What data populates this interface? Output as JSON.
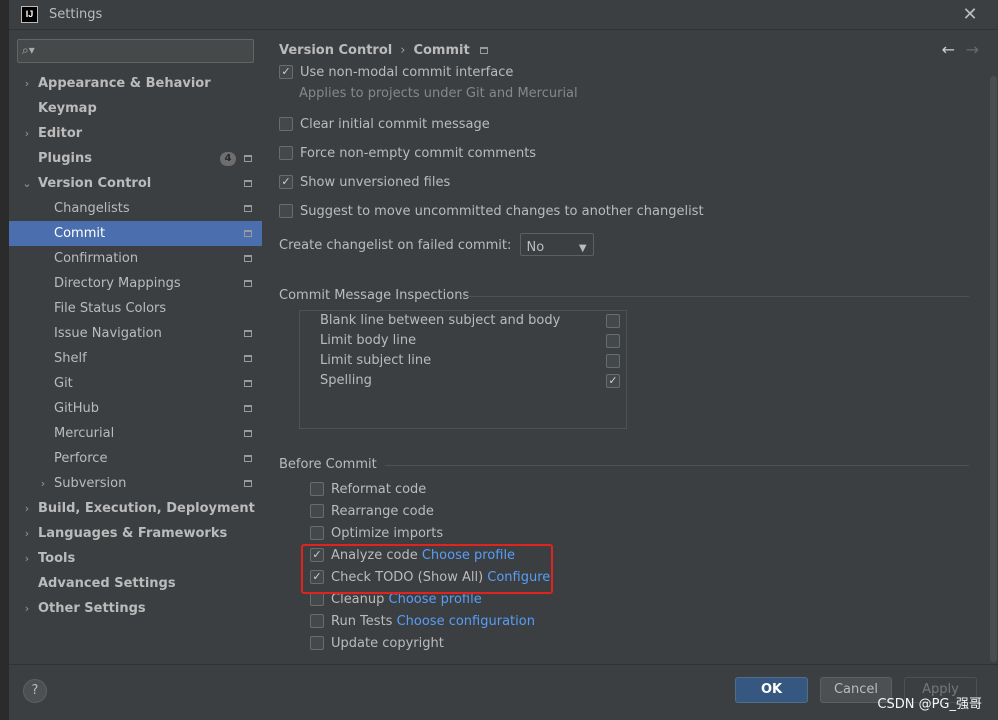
{
  "window": {
    "title": "Settings",
    "app_icon_text": "IJ"
  },
  "search": {
    "placeholder": "",
    "value": ""
  },
  "sidebar": {
    "items": [
      {
        "label": "Appearance & Behavior",
        "arrow": "›",
        "bold": true
      },
      {
        "label": "Keymap",
        "arrow": "",
        "bold": true
      },
      {
        "label": "Editor",
        "arrow": "›",
        "bold": true
      },
      {
        "label": "Plugins",
        "arrow": "",
        "bold": true,
        "badge": "4"
      },
      {
        "label": "Version Control",
        "arrow": "⌄",
        "bold": true
      },
      {
        "label": "Changelists"
      },
      {
        "label": "Commit",
        "selected": true
      },
      {
        "label": "Confirmation"
      },
      {
        "label": "Directory Mappings"
      },
      {
        "label": "File Status Colors"
      },
      {
        "label": "Issue Navigation"
      },
      {
        "label": "Shelf"
      },
      {
        "label": "Git"
      },
      {
        "label": "GitHub"
      },
      {
        "label": "Mercurial"
      },
      {
        "label": "Perforce"
      },
      {
        "label": "Subversion",
        "arrow": "›"
      },
      {
        "label": "Build, Execution, Deployment",
        "arrow": "›",
        "bold": true
      },
      {
        "label": "Languages & Frameworks",
        "arrow": "›",
        "bold": true
      },
      {
        "label": "Tools",
        "arrow": "›",
        "bold": true
      },
      {
        "label": "Advanced Settings",
        "arrow": "",
        "bold": true
      },
      {
        "label": "Other Settings",
        "arrow": "›",
        "bold": true
      }
    ]
  },
  "header": {
    "crumb1": "Version Control",
    "sep": "›",
    "crumb2": "Commit",
    "back": "←",
    "forward": "→"
  },
  "options": {
    "non_modal": {
      "label": "Use non-modal commit interface",
      "checked": true,
      "hint": "Applies to projects under Git and Mercurial"
    },
    "clear_initial": {
      "label": "Clear initial commit message",
      "checked": false
    },
    "force_nonempty": {
      "label": "Force non-empty commit comments",
      "checked": false
    },
    "show_unversioned": {
      "label": "Show unversioned files",
      "checked": true
    },
    "suggest_move": {
      "label": "Suggest to move uncommitted changes to another changelist",
      "checked": false
    },
    "failed_commit": {
      "label": "Create changelist on failed commit:",
      "value": "No"
    }
  },
  "inspections": {
    "title": "Commit Message Inspections",
    "items": [
      {
        "label": "Blank line between subject and body",
        "checked": false
      },
      {
        "label": "Limit body line",
        "checked": false
      },
      {
        "label": "Limit subject line",
        "checked": false
      },
      {
        "label": "Spelling",
        "checked": true
      }
    ]
  },
  "before_commit": {
    "title": "Before Commit",
    "items": [
      {
        "label": "Reformat code",
        "checked": false,
        "link": ""
      },
      {
        "label": "Rearrange code",
        "checked": false,
        "link": ""
      },
      {
        "label": "Optimize imports",
        "checked": false,
        "link": ""
      },
      {
        "label": "Analyze code",
        "checked": true,
        "link": "Choose profile"
      },
      {
        "label": "Check TODO (Show All)",
        "checked": true,
        "link": "Configure"
      },
      {
        "label": "Cleanup",
        "checked": false,
        "link": "Choose profile"
      },
      {
        "label": "Run Tests",
        "checked": false,
        "link": "Choose configuration"
      },
      {
        "label": "Update copyright",
        "checked": false,
        "link": ""
      }
    ]
  },
  "footer": {
    "help": "?",
    "ok": "OK",
    "cancel": "Cancel",
    "apply": "Apply"
  },
  "watermark": "CSDN @PG_强哥",
  "colors": {
    "selection": "#4b6eaf",
    "link": "#589df6",
    "highlight": "#e0231e",
    "ok_button": "#365880"
  }
}
